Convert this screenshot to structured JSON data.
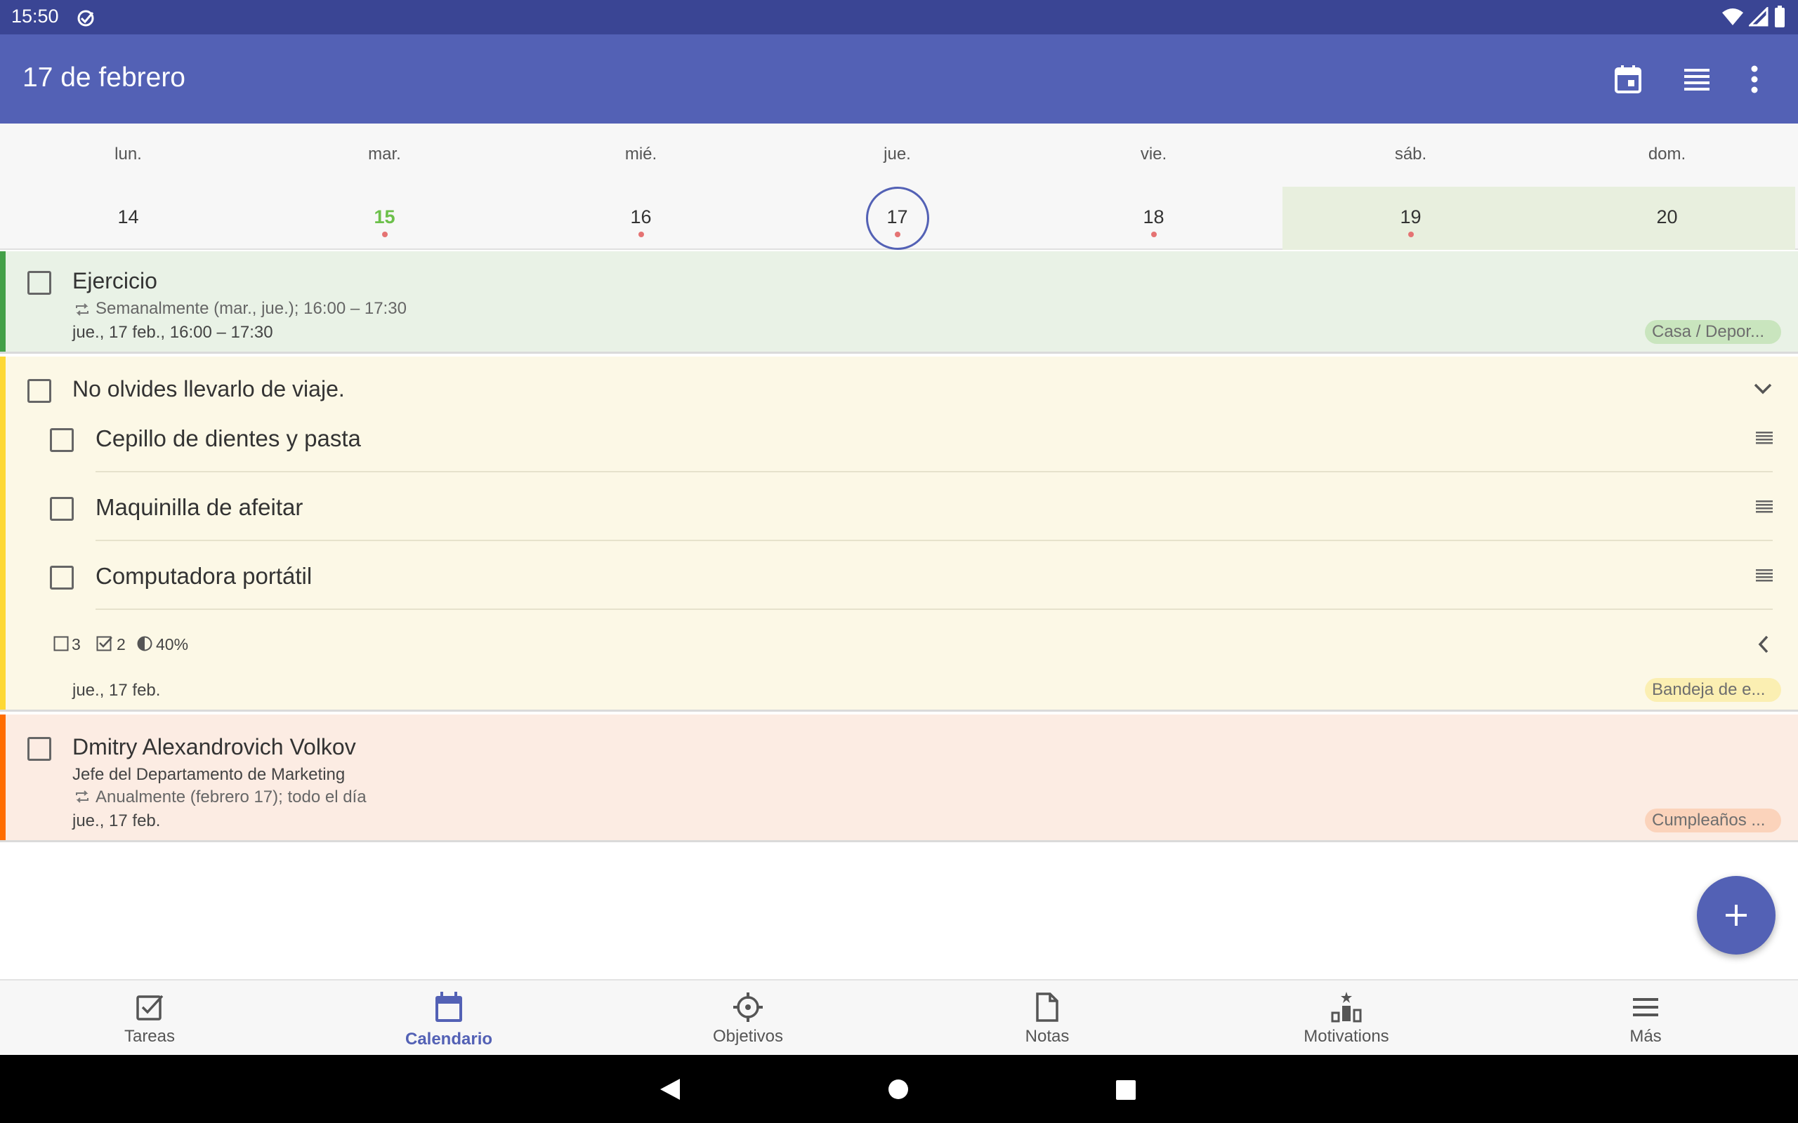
{
  "status_bar": {
    "time": "15:50"
  },
  "app_bar": {
    "title": "17 de febrero"
  },
  "week": {
    "days": [
      {
        "name": "lun.",
        "num": "14"
      },
      {
        "name": "mar.",
        "num": "15"
      },
      {
        "name": "mié.",
        "num": "16"
      },
      {
        "name": "jue.",
        "num": "17"
      },
      {
        "name": "vie.",
        "num": "18"
      },
      {
        "name": "sáb.",
        "num": "19"
      },
      {
        "name": "dom.",
        "num": "20"
      }
    ]
  },
  "tasks": {
    "exercise": {
      "title": "Ejercicio",
      "repeat": "Semanalmente (mar., jue.); 16:00 – 17:30",
      "date": "jue., 17 feb., 16:00 – 17:30",
      "tag": "Casa / Depor..."
    },
    "trip": {
      "title": "No olvides llevarlo de viaje.",
      "items": [
        {
          "label": "Cepillo de dientes y pasta"
        },
        {
          "label": "Maquinilla de afeitar"
        },
        {
          "label": "Computadora portátil"
        }
      ],
      "stats": {
        "open": "3",
        "done": "2",
        "progress": "40%"
      },
      "date": "jue., 17 feb.",
      "tag": "Bandeja de e..."
    },
    "birthday": {
      "title": "Dmitry Alexandrovich Volkov",
      "subtitle": "Jefe del Departamento de Marketing",
      "repeat": "Anualmente (febrero 17); todo el día",
      "date": "jue., 17 feb.",
      "tag": "Cumpleaños ..."
    }
  },
  "nav": {
    "items": [
      {
        "label": "Tareas",
        "icon": "tasks-check-icon"
      },
      {
        "label": "Calendario",
        "icon": "calendar-icon"
      },
      {
        "label": "Objetivos",
        "icon": "target-icon"
      },
      {
        "label": "Notas",
        "icon": "note-icon"
      },
      {
        "label": "Motivations",
        "icon": "podium-icon"
      },
      {
        "label": "Más",
        "icon": "menu-icon"
      }
    ]
  },
  "colors": {
    "primary": "#5361b5",
    "status_bar": "#3a4594",
    "exercise_stripe": "#43a047",
    "trip_stripe": "#fdd835",
    "birthday_stripe": "#ff6d00",
    "today_green": "#6cc04a"
  }
}
